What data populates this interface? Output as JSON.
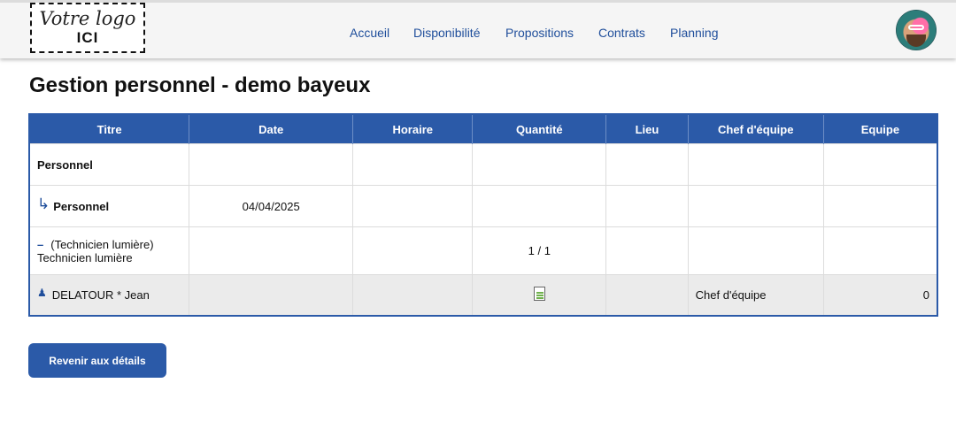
{
  "header": {
    "logo_line1": "Votre logo",
    "logo_line2": "ICI",
    "nav": [
      "Accueil",
      "Disponibilité",
      "Propositions",
      "Contrats",
      "Planning"
    ]
  },
  "page": {
    "title": "Gestion personnel - demo bayeux"
  },
  "table": {
    "columns": [
      "Titre",
      "Date",
      "Horaire",
      "Quantité",
      "Lieu",
      "Chef d'équipe",
      "Equipe"
    ],
    "rows": [
      {
        "titre": "Personnel"
      },
      {
        "titre": "Personnel",
        "date": "04/04/2025"
      },
      {
        "titre_line1": "(Technicien lumière)",
        "titre_line2": "Technicien lumière",
        "quantite": "1 / 1"
      },
      {
        "titre": "DELATOUR * Jean",
        "chef": "Chef d'équipe",
        "equipe": "0"
      }
    ]
  },
  "icons": {
    "sub_arrow": "subitem-arrow-icon",
    "dash": "minus-icon",
    "person": "person-icon",
    "doc": "document-icon"
  },
  "colors": {
    "accent": "#2b5aa8",
    "link": "#1f4e9b",
    "highlight_row": "#ebebeb"
  },
  "actions": {
    "back_label": "Revenir aux détails"
  }
}
